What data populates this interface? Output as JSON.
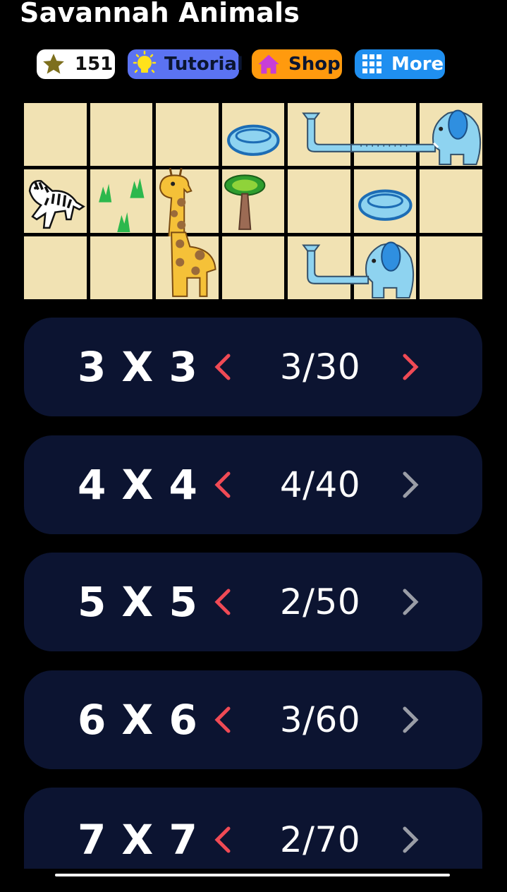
{
  "app": {
    "title": "Savannah Animals"
  },
  "toolbar": {
    "coins": {
      "value": "151",
      "icon": "star-icon",
      "color": "#8a7a22"
    },
    "tutorial": {
      "label": "Tutorial",
      "icon": "lightbulb-icon",
      "color": "#5b73f2"
    },
    "shop": {
      "label": "Shop",
      "icon": "house-icon",
      "color": "#ff9a0e"
    },
    "more": {
      "label": "More",
      "icon": "grid-icon",
      "color": "#1f8ff0"
    }
  },
  "board": {
    "rows": 3,
    "cols": 7,
    "tiles": [
      [
        "empty",
        "empty",
        "empty",
        "pond",
        "elephant-trunk-start",
        "elephant-trunk",
        "elephant-head"
      ],
      [
        "zebra",
        "grass",
        "giraffe-head",
        "tree",
        "empty",
        "pond",
        "empty"
      ],
      [
        "empty",
        "empty",
        "giraffe-body",
        "empty",
        "elephant-trunk-start",
        "elephant-head",
        "empty"
      ]
    ]
  },
  "levels": [
    {
      "size": "3 X 3",
      "progress": "3/30",
      "next_enabled": true
    },
    {
      "size": "4 X 4",
      "progress": "4/40",
      "next_enabled": false
    },
    {
      "size": "5 X 5",
      "progress": "2/50",
      "next_enabled": false
    },
    {
      "size": "6 X 6",
      "progress": "3/60",
      "next_enabled": false
    },
    {
      "size": "7 X 7",
      "progress": "2/70",
      "next_enabled": false
    }
  ],
  "colors": {
    "card": "#0c1431",
    "arrow_active": "#f04a55",
    "arrow_inactive": "#9a9da6",
    "tile": "#f1e2b3"
  }
}
